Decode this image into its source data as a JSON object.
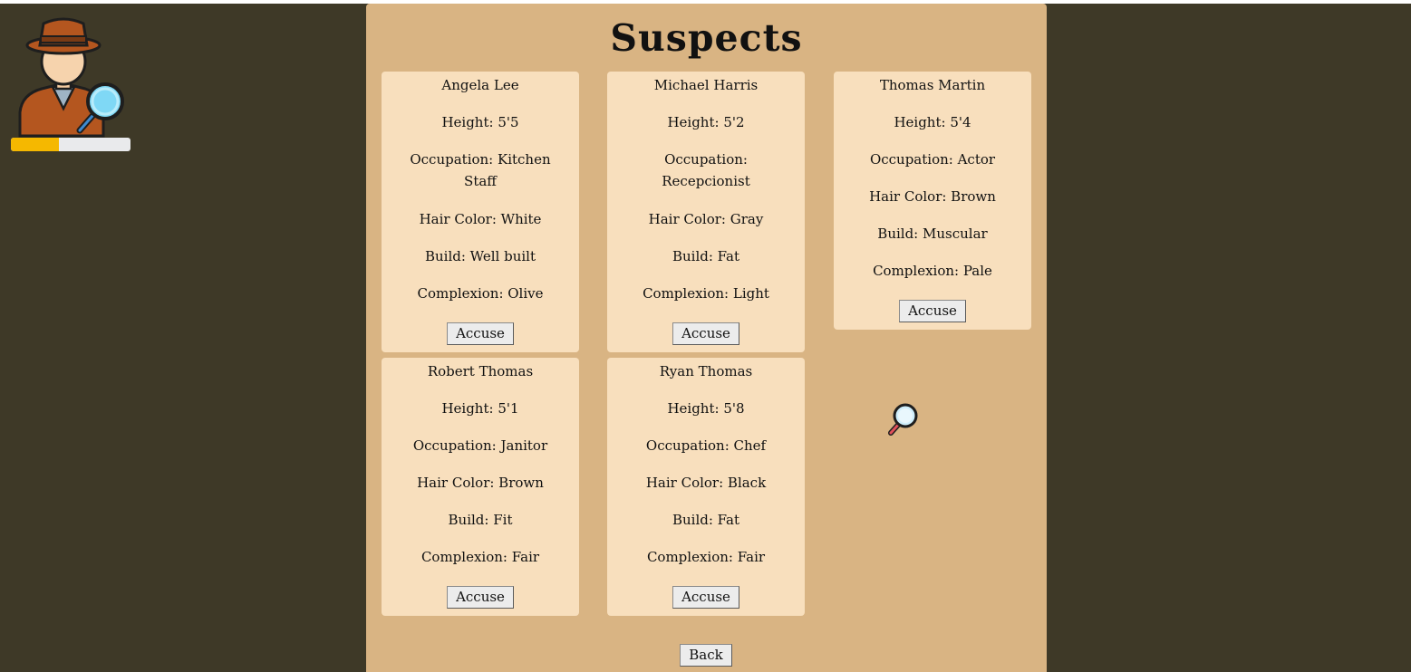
{
  "header": {
    "title": "Suspects",
    "progress_fraction": 0.4
  },
  "suspects": [
    {
      "name": "Angela Lee",
      "height": "Height: 5'5",
      "occupation_line1": "Occupation: Kitchen",
      "occupation_line2": "Staff",
      "hair": "Hair Color: White",
      "build": "Build: Well built",
      "complexion": "Complexion: Olive",
      "accuse_label": "Accuse"
    },
    {
      "name": "Michael Harris",
      "height": "Height: 5'2",
      "occupation_line1": "Occupation:",
      "occupation_line2": "Recepcionist",
      "hair": "Hair Color: Gray",
      "build": "Build: Fat",
      "complexion": "Complexion: Light",
      "accuse_label": "Accuse"
    },
    {
      "name": "Thomas Martin",
      "height": "Height: 5'4",
      "occupation_line1": "Occupation: Actor",
      "occupation_line2": "",
      "hair": "Hair Color: Brown",
      "build": "Build: Muscular",
      "complexion": "Complexion: Pale",
      "accuse_label": "Accuse"
    },
    {
      "name": "Robert Thomas",
      "height": "Height: 5'1",
      "occupation_line1": "Occupation: Janitor",
      "occupation_line2": "",
      "hair": "Hair Color: Brown",
      "build": "Build: Fit",
      "complexion": "Complexion: Fair",
      "accuse_label": "Accuse"
    },
    {
      "name": "Ryan Thomas",
      "height": "Height: 5'8",
      "occupation_line1": "Occupation: Chef",
      "occupation_line2": "",
      "hair": "Hair Color: Black",
      "build": "Build: Fat",
      "complexion": "Complexion: Fair",
      "accuse_label": "Accuse"
    }
  ],
  "footer": {
    "back_label": "Back"
  },
  "icons": {
    "avatar": "detective-icon",
    "cursor": "magnifying-glass-icon"
  },
  "colors": {
    "background": "#3e3927",
    "panel": "#d9b483",
    "card": "#f8dfbd",
    "progress_fill": "#f5b800",
    "progress_track": "#e9eaec"
  }
}
